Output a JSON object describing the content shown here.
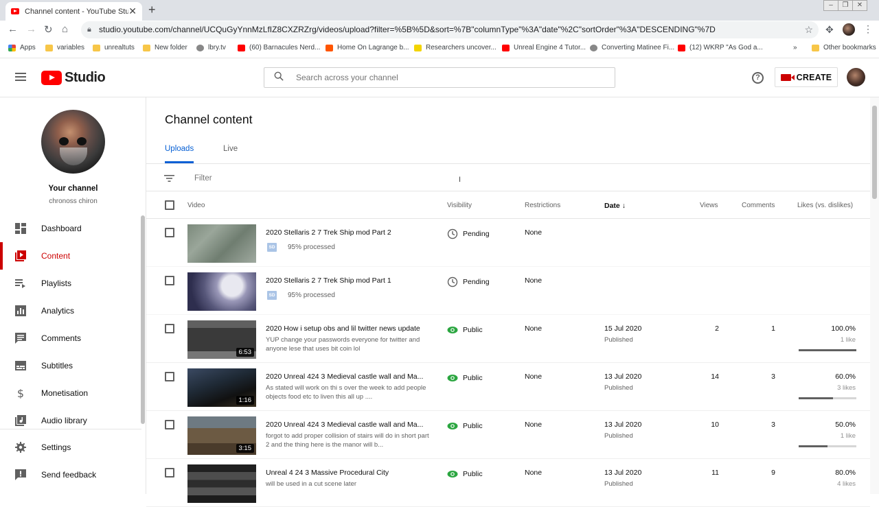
{
  "browser": {
    "tab_title": "Channel content - YouTube Studio",
    "url": "studio.youtube.com/channel/UCQuGyYnnMzLfIZ8CXZRZrg/videos/upload?filter=%5B%5D&sort=%7B\"columnType\"%3A\"date\"%2C\"sortOrder\"%3A\"DESCENDING\"%7D",
    "bookmarks": [
      {
        "label": "Apps",
        "kind": "apps"
      },
      {
        "label": "variables",
        "kind": "folder"
      },
      {
        "label": "unrealtuts",
        "kind": "folder"
      },
      {
        "label": "New folder",
        "kind": "folder"
      },
      {
        "label": "lbry.tv",
        "kind": "gray"
      },
      {
        "label": "(60) Barnacules Nerd...",
        "kind": "yt"
      },
      {
        "label": "Home On Lagrange b...",
        "kind": "sc"
      },
      {
        "label": "Researchers uncover...",
        "kind": "ylw"
      },
      {
        "label": "Unreal Engine 4 Tutor...",
        "kind": "yt"
      },
      {
        "label": "Converting Matinee Fi...",
        "kind": "gray"
      },
      {
        "label": "(12) WKRP \"As God a...",
        "kind": "yt"
      }
    ],
    "bookmarks_more": "»",
    "other_bookmarks": "Other bookmarks"
  },
  "header": {
    "logo_text": "Studio",
    "search_placeholder": "Search across your channel",
    "help_glyph": "?",
    "create_label": "CREATE"
  },
  "sidebar": {
    "channel_title": "Your channel",
    "channel_name": "chronoss chiron",
    "items": [
      {
        "label": "Dashboard",
        "icon": "dashboard-icon",
        "active": false
      },
      {
        "label": "Content",
        "icon": "content-icon",
        "active": true
      },
      {
        "label": "Playlists",
        "icon": "playlists-icon",
        "active": false
      },
      {
        "label": "Analytics",
        "icon": "analytics-icon",
        "active": false
      },
      {
        "label": "Comments",
        "icon": "comments-icon",
        "active": false
      },
      {
        "label": "Subtitles",
        "icon": "subtitles-icon",
        "active": false
      },
      {
        "label": "Monetisation",
        "icon": "dollar-icon",
        "active": false
      },
      {
        "label": "Audio library",
        "icon": "audio-library-icon",
        "active": false
      },
      {
        "label": "Settings",
        "icon": "gear-icon",
        "active": false
      },
      {
        "label": "Send feedback",
        "icon": "feedback-icon",
        "active": false
      }
    ]
  },
  "main": {
    "title": "Channel content",
    "tabs": [
      "Uploads",
      "Live"
    ],
    "filter_placeholder": "Filter",
    "columns": {
      "video": "Video",
      "visibility": "Visibility",
      "restrictions": "Restrictions",
      "date": "Date",
      "views": "Views",
      "comments": "Comments",
      "likes": "Likes (vs. dislikes)"
    },
    "rows": [
      {
        "title": "2020 Stellaris 2 7 Trek Ship mod Part 2",
        "desc": "",
        "duration": "",
        "processing": "95% processed",
        "sd": "SD",
        "visibility": "Pending",
        "restrictions": "None",
        "date": "",
        "status": "",
        "views": "",
        "comments": "",
        "likes_pct": "",
        "likes_count": "",
        "like_ratio": null,
        "thumb": "space"
      },
      {
        "title": "2020 Stellaris 2 7 Trek Ship mod Part 1",
        "desc": "",
        "duration": "",
        "processing": "95% processed",
        "sd": "SD",
        "visibility": "Pending",
        "restrictions": "None",
        "date": "",
        "status": "",
        "views": "",
        "comments": "",
        "likes_pct": "",
        "likes_count": "",
        "like_ratio": null,
        "thumb": "planet"
      },
      {
        "title": "2020 How i setup obs and lil twitter news update",
        "desc": "YUP change your passwords everyone for twitter and anyone lese that uses bit coin lol",
        "duration": "6:53",
        "processing": "",
        "sd": "",
        "visibility": "Public",
        "restrictions": "None",
        "date": "15 Jul 2020",
        "status": "Published",
        "views": "2",
        "comments": "1",
        "likes_pct": "100.0%",
        "likes_count": "1 like",
        "like_ratio": 1.0,
        "thumb": "obs"
      },
      {
        "title": "2020 Unreal 424 3 Medieval castle wall and Ma...",
        "desc": "As stated will work on thi s over the week to add people objects food etc to liven this all up ....",
        "duration": "1:16",
        "processing": "",
        "sd": "",
        "visibility": "Public",
        "restrictions": "None",
        "date": "13 Jul 2020",
        "status": "Published",
        "views": "14",
        "comments": "3",
        "likes_pct": "60.0%",
        "likes_count": "3 likes",
        "like_ratio": 0.6,
        "thumb": "castle"
      },
      {
        "title": "2020 Unreal 424 3 Medieval castle wall and Ma...",
        "desc": "forgot to add proper collision of stairs will do in short part 2 and the thing here is the manor will b...",
        "duration": "3:15",
        "processing": "",
        "sd": "",
        "visibility": "Public",
        "restrictions": "None",
        "date": "13 Jul 2020",
        "status": "Published",
        "views": "10",
        "comments": "3",
        "likes_pct": "50.0%",
        "likes_count": "1 like",
        "like_ratio": 0.5,
        "thumb": "courtyard"
      },
      {
        "title": "Unreal 4 24 3 Massive Procedural City",
        "desc": "will be used in a cut scene later",
        "duration": "",
        "processing": "",
        "sd": "",
        "visibility": "Public",
        "restrictions": "None",
        "date": "13 Jul 2020",
        "status": "Published",
        "views": "11",
        "comments": "9",
        "likes_pct": "80.0%",
        "likes_count": "4 likes",
        "like_ratio": 0.8,
        "thumb": "city"
      }
    ]
  },
  "colors": {
    "accent_red": "#cc0000",
    "tab_blue": "#065fd4",
    "public_green": "#2ba640"
  }
}
